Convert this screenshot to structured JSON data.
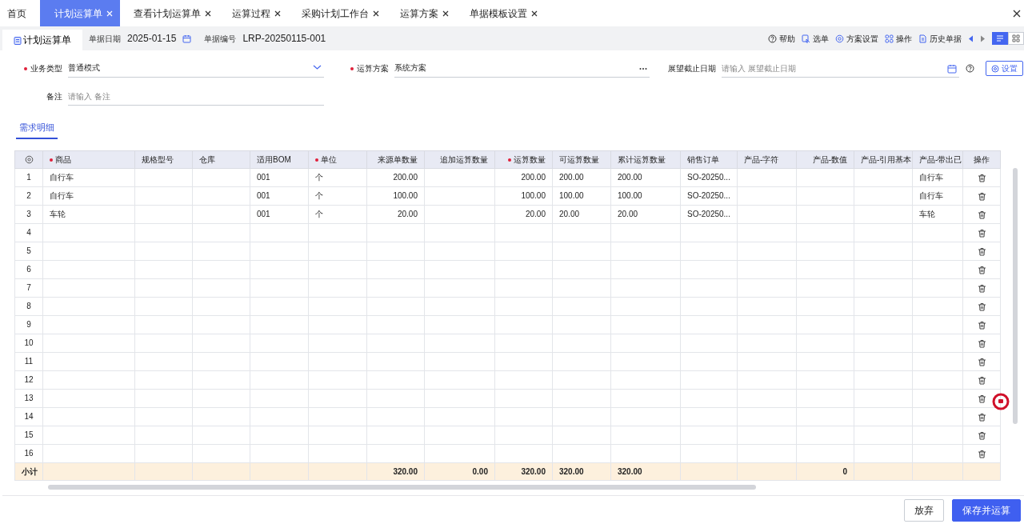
{
  "top_tabs": [
    {
      "label": "首页",
      "selected": false,
      "closable": false
    },
    {
      "label": "计划运算单",
      "selected": true,
      "closable": true
    },
    {
      "label": "查看计划运算单",
      "selected": false,
      "closable": true
    },
    {
      "label": "运算过程",
      "selected": false,
      "closable": true
    },
    {
      "label": "采购计划工作台",
      "selected": false,
      "closable": true
    },
    {
      "label": "运算方案",
      "selected": false,
      "closable": true
    },
    {
      "label": "单据模板设置",
      "selected": false,
      "closable": true
    }
  ],
  "doc_header": {
    "title": "计划运算单",
    "date_label": "单据日期",
    "date": "2025-01-15",
    "number_label": "单据编号",
    "number": "LRP-20250115-001"
  },
  "toolbar": [
    "帮助",
    "选单",
    "方案设置",
    "操作",
    "历史单据"
  ],
  "view_toggle": [
    {
      "kind": "list",
      "selected": true
    },
    {
      "kind": "grid",
      "selected": false
    }
  ],
  "form": [
    {
      "label": "业务类型",
      "required": true,
      "value": "普通模式",
      "kind": "select"
    },
    {
      "label": "运算方案",
      "required": true,
      "value": "系统方案",
      "kind": "lookup"
    },
    {
      "label": "展望截止日期",
      "required": false,
      "placeholder": "请输入 展望截止日期",
      "kind": "date"
    },
    {
      "label": "备注",
      "required": false,
      "placeholder": "请输入 备注",
      "kind": "text"
    }
  ],
  "settings_button": "设置",
  "section_tabs": [
    {
      "label": "需求明细",
      "selected": true
    }
  ],
  "table": {
    "columns": [
      {
        "kind": "settings"
      },
      {
        "label": "商品",
        "required": true
      },
      {
        "label": "规格型号",
        "required": false
      },
      {
        "label": "仓库",
        "required": false
      },
      {
        "label": "适用BOM",
        "required": false
      },
      {
        "label": "单位",
        "required": true
      },
      {
        "label": "来源单数量",
        "required": false
      },
      {
        "label": "追加运算数量",
        "required": false
      },
      {
        "label": "运算数量",
        "required": true
      },
      {
        "label": "可运算数量",
        "required": false
      },
      {
        "label": "累计运算数量",
        "required": false
      },
      {
        "label": "销售订单",
        "required": false
      },
      {
        "label": "产品-字符",
        "required": false
      },
      {
        "label": "产品-数值",
        "required": false
      },
      {
        "label": "产品-引用基本",
        "required": false
      },
      {
        "label": "产品-带出已",
        "required": false
      },
      {
        "label": "操作",
        "kind": "actions"
      }
    ],
    "rows": [
      {
        "no": "1",
        "item": "自行车",
        "bom": "001",
        "unit": "个",
        "source_qty": "200.00",
        "calc_qty": "200.00",
        "avail_qty": "200.00",
        "cum_qty": "200.00",
        "sales_order": "SO-20250...",
        "product_carry": "自行车"
      },
      {
        "no": "2",
        "item": "自行车",
        "bom": "001",
        "unit": "个",
        "source_qty": "100.00",
        "calc_qty": "100.00",
        "avail_qty": "100.00",
        "cum_qty": "100.00",
        "sales_order": "SO-20250...",
        "product_carry": "自行车"
      },
      {
        "no": "3",
        "item": "车轮",
        "bom": "001",
        "unit": "个",
        "source_qty": "20.00",
        "calc_qty": "20.00",
        "avail_qty": "20.00",
        "cum_qty": "20.00",
        "sales_order": "SO-20250...",
        "product_carry": "车轮"
      },
      {
        "no": "4"
      },
      {
        "no": "5"
      },
      {
        "no": "6"
      },
      {
        "no": "7"
      },
      {
        "no": "8"
      },
      {
        "no": "9"
      },
      {
        "no": "10"
      },
      {
        "no": "11"
      },
      {
        "no": "12"
      },
      {
        "no": "13"
      },
      {
        "no": "14"
      },
      {
        "no": "15"
      },
      {
        "no": "16"
      }
    ],
    "subtotal": {
      "label": "小计",
      "source_qty": "320.00",
      "add_qty": "0.00",
      "calc_qty": "320.00",
      "avail_qty": "320.00",
      "cum_qty": "320.00",
      "product_num": "0"
    }
  },
  "actions": [
    {
      "label": "放弃",
      "kind": "secondary"
    },
    {
      "label": "保存并运算",
      "kind": "primary"
    }
  ]
}
